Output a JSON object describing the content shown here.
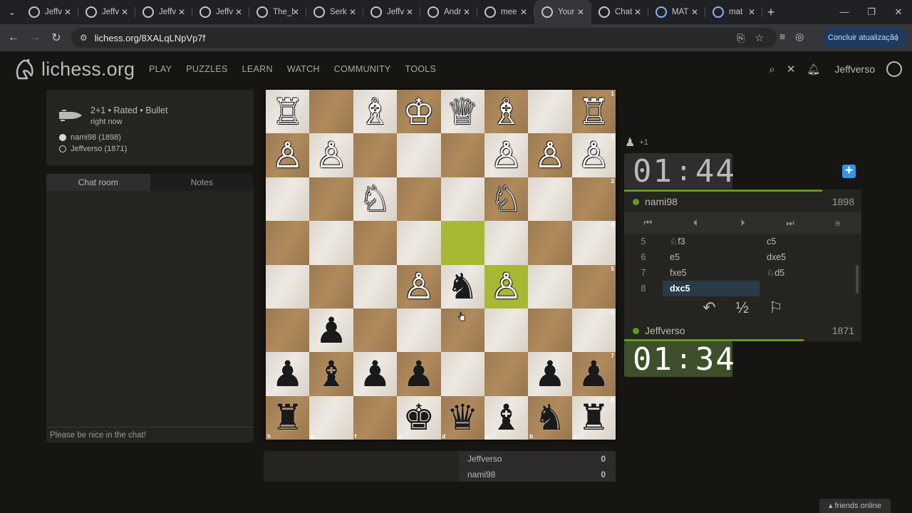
{
  "browser": {
    "tabs": [
      {
        "label": "Jeffv",
        "icon": "lichess-icon"
      },
      {
        "label": "Jeffv",
        "icon": "lichess-icon"
      },
      {
        "label": "Jeffv",
        "icon": "lichess-icon"
      },
      {
        "label": "Jeffv",
        "icon": "lichess-icon"
      },
      {
        "label": "The_l",
        "icon": "lichess-icon"
      },
      {
        "label": "Serk",
        "icon": "lichess-icon"
      },
      {
        "label": "Jeffv",
        "icon": "lichess-icon"
      },
      {
        "label": "Andr",
        "icon": "lichess-icon"
      },
      {
        "label": "mee",
        "icon": "lichess-icon"
      },
      {
        "label": "Your",
        "icon": "lichess-icon",
        "active": true
      },
      {
        "label": "Chat",
        "icon": "openai-icon"
      },
      {
        "label": "MAT",
        "icon": "google-icon"
      },
      {
        "label": "mat",
        "icon": "google-icon"
      }
    ],
    "url": "lichess.org/8XALqLNpVp7f",
    "update_label": "Concluir atualização"
  },
  "site": {
    "logo_text": "lichess.org",
    "nav": [
      "PLAY",
      "PUZZLES",
      "LEARN",
      "WATCH",
      "COMMUNITY",
      "TOOLS"
    ],
    "username": "Jeffverso"
  },
  "game": {
    "title": "2+1 • Rated • Bullet",
    "time_ago": "right now",
    "white_player": "nami98 (1898)",
    "black_player": "Jeffverso (1871)"
  },
  "chat": {
    "tab_chat": "Chat room",
    "tab_notes": "Notes",
    "placeholder": "Please be nice in the chat!"
  },
  "board": {
    "orientation": "black",
    "rank_labels": [
      "1",
      "2",
      "3",
      "4",
      "5",
      "6",
      "7",
      "8"
    ],
    "file_labels": [
      "h",
      "g",
      "f",
      "e",
      "d",
      "c",
      "b",
      "a"
    ],
    "rows": [
      [
        "wR",
        "",
        "wB",
        "wK",
        "wQ",
        "wB",
        "",
        "wR"
      ],
      [
        "wP",
        "wP",
        "",
        "",
        "",
        "wP",
        "wP",
        "wP"
      ],
      [
        "",
        "",
        "wN",
        "",
        "",
        "wN",
        "",
        ""
      ],
      [
        "",
        "",
        "",
        "",
        "",
        "",
        "",
        ""
      ],
      [
        "",
        "",
        "",
        "wP",
        "bN",
        "wP",
        "",
        ""
      ],
      [
        "",
        "bP",
        "",
        "",
        "",
        "",
        "",
        ""
      ],
      [
        "bP",
        "bB",
        "bP",
        "bP",
        "",
        "",
        "bP",
        "bP"
      ],
      [
        "bR",
        "",
        "",
        "bK",
        "bQ",
        "bB",
        "bN",
        "bR"
      ]
    ],
    "highlights": [
      "d4",
      "c5"
    ]
  },
  "crosstable": [
    {
      "name": "Jeffverso",
      "score": "0"
    },
    {
      "name": "nami98",
      "score": "0"
    }
  ],
  "top_player": {
    "name": "nami98",
    "rating": "1898",
    "clock_min": "01",
    "clock_sec": "44",
    "material": "+1"
  },
  "bottom_player": {
    "name": "Jeffverso",
    "rating": "1871",
    "clock_min": "01",
    "clock_sec": "34"
  },
  "moves": [
    {
      "no": "5",
      "white": "♘f3",
      "black": "c5"
    },
    {
      "no": "6",
      "white": "e5",
      "black": "dxe5"
    },
    {
      "no": "7",
      "white": "fxe5",
      "black": "♘d5"
    },
    {
      "no": "8",
      "white": "dxc5",
      "black": ""
    }
  ],
  "friends_label": "friends online"
}
